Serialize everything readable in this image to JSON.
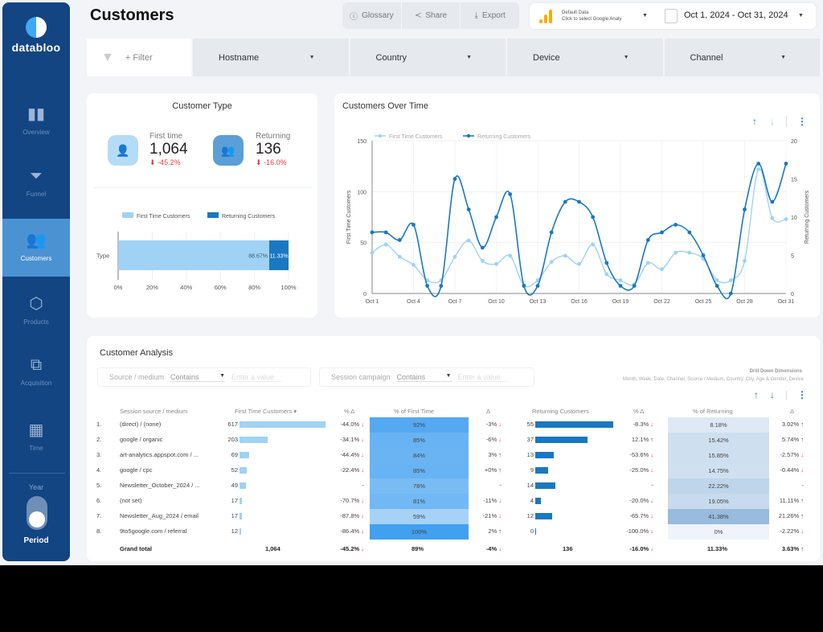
{
  "sidebar": {
    "brand": "databloo",
    "items": [
      {
        "label": "Overview",
        "icon": "bar-chart-icon",
        "active": false
      },
      {
        "label": "Funnel",
        "icon": "funnel-icon",
        "active": false
      },
      {
        "label": "Customers",
        "icon": "users-icon",
        "active": true
      },
      {
        "label": "Products",
        "icon": "box-icon",
        "active": false
      },
      {
        "label": "Acquisition",
        "icon": "hierarchy-icon",
        "active": false
      },
      {
        "label": "Time",
        "icon": "calendar-icon",
        "active": false
      }
    ],
    "toggle_top": "Year",
    "toggle_bottom": "Period"
  },
  "header": {
    "title": "Customers",
    "glossary": "Glossary",
    "share": "Share",
    "export": "Export",
    "datasource_line1": "Default Data",
    "datasource_line2": "Click to select Google Analy",
    "date_range": "Oct 1, 2024 - Oct 31, 2024"
  },
  "filters": {
    "add": "+ Filter",
    "dropdowns": [
      "Hostname",
      "Country",
      "Device",
      "Channel"
    ]
  },
  "customer_type": {
    "title": "Customer Type",
    "first": {
      "label": "First time",
      "value": "1,064",
      "delta": "-45.2%"
    },
    "returning": {
      "label": "Returning",
      "value": "136",
      "delta": "-16.0%"
    }
  },
  "over_time": {
    "title": "Customers Over Time"
  },
  "analysis": {
    "title": "Customer Analysis",
    "filter1": {
      "label": "Source / medium",
      "op": "Contains",
      "placeholder": "Enter a value"
    },
    "filter2": {
      "label": "Session campaign",
      "op": "Contains",
      "placeholder": "Enter a value"
    },
    "drill_title": "Drill Down Dimensions",
    "drill_list": "Month, Week, Date, Channel, Source / Medium,  Country, City, Age & Gender, Device",
    "headers": [
      "Session source / medium",
      "First Time Customers ▾",
      "% Δ",
      "% of First Time",
      "Δ",
      "Returning Customers",
      "% Δ",
      "% of Returning",
      "Δ"
    ],
    "rows": [
      {
        "n": "1.",
        "src": "(direct) / (none)",
        "ft": 617,
        "ftd": "-44.0%",
        "ftdd": "down",
        "pft": "92%",
        "pftv": 92,
        "d1": "-3%",
        "d1d": "down",
        "rt": 55,
        "rtd": "-8.3%",
        "rtdd": "down",
        "prt": "8.18%",
        "prtv": 8.18,
        "d2": "3.02%",
        "d2d": "up"
      },
      {
        "n": "2.",
        "src": "google / organic",
        "ft": 203,
        "ftd": "-34.1%",
        "ftdd": "down",
        "pft": "85%",
        "pftv": 85,
        "d1": "-6%",
        "d1d": "down",
        "rt": 37,
        "rtd": "12.1%",
        "rtdd": "up",
        "prt": "15.42%",
        "prtv": 15.42,
        "d2": "5.74%",
        "d2d": "up"
      },
      {
        "n": "3.",
        "src": "art-analytics.appspot.com / ...",
        "ft": 69,
        "ftd": "-44.4%",
        "ftdd": "down",
        "pft": "84%",
        "pftv": 84,
        "d1": "3%",
        "d1d": "up",
        "rt": 13,
        "rtd": "-53.6%",
        "rtdd": "down",
        "prt": "15.85%",
        "prtv": 15.85,
        "d2": "-2.57%",
        "d2d": "down"
      },
      {
        "n": "4.",
        "src": "google / cpc",
        "ft": 52,
        "ftd": "-22.4%",
        "ftdd": "down",
        "pft": "85%",
        "pftv": 85,
        "d1": "+0%",
        "d1d": "up",
        "rt": 9,
        "rtd": "-25.0%",
        "rtdd": "down",
        "prt": "14.75%",
        "prtv": 14.75,
        "d2": "-0.44%",
        "d2d": "down"
      },
      {
        "n": "5.",
        "src": "Newsletter_October_2024 / ...",
        "ft": 49,
        "ftd": "-",
        "ftdd": "",
        "pft": "78%",
        "pftv": 78,
        "d1": "-",
        "d1d": "",
        "rt": 14,
        "rtd": "-",
        "rtdd": "",
        "prt": "22.22%",
        "prtv": 22.22,
        "d2": "-",
        "d2d": ""
      },
      {
        "n": "6.",
        "src": "(not set)",
        "ft": 17,
        "ftd": "-70.7%",
        "ftdd": "down",
        "pft": "81%",
        "pftv": 81,
        "d1": "-11%",
        "d1d": "down",
        "rt": 4,
        "rtd": "-20.0%",
        "rtdd": "down",
        "prt": "19.05%",
        "prtv": 19.05,
        "d2": "11.11%",
        "d2d": "up"
      },
      {
        "n": "7.",
        "src": "Newsletter_Aug_2024 / email",
        "ft": 17,
        "ftd": "-87.8%",
        "ftdd": "down",
        "pft": "59%",
        "pftv": 59,
        "d1": "-21%",
        "d1d": "down",
        "rt": 12,
        "rtd": "-65.7%",
        "rtdd": "down",
        "prt": "41.38%",
        "prtv": 41.38,
        "d2": "21.26%",
        "d2d": "up"
      },
      {
        "n": "8.",
        "src": "9to5google.com / referral",
        "ft": 12,
        "ftd": "-86.4%",
        "ftdd": "down",
        "pft": "100%",
        "pftv": 100,
        "d1": "2%",
        "d1d": "up",
        "rt": 0,
        "rtd": "-100.0%",
        "rtdd": "down",
        "prt": "0%",
        "prtv": 0,
        "d2": "-2.22%",
        "d2d": "down"
      }
    ],
    "total": {
      "label": "Grand total",
      "ft": "1,064",
      "ftd": "-45.2%",
      "ftdd": "down",
      "pft": "89%",
      "d1": "-4%",
      "d1d": "down",
      "rt": "136",
      "rtd": "-16.0%",
      "rtdd": "down",
      "prt": "11.33%",
      "d2": "3.63%",
      "d2d": "up"
    }
  },
  "colors": {
    "sidebar": "#124581",
    "active": "#4b92d3",
    "first": "#9fd2f5",
    "returning": "#1a78c2",
    "negative": "#e23c3c"
  },
  "chart_data": [
    {
      "type": "bar",
      "stacked": true,
      "orientation": "horizontal",
      "categories": [
        "Type"
      ],
      "series": [
        {
          "name": "First Time Customers",
          "values": [
            88.67
          ],
          "label": "88.67%"
        },
        {
          "name": "Returning Customers",
          "values": [
            11.33
          ],
          "label": "11.33%"
        }
      ],
      "xlim": [
        0,
        100
      ],
      "xticks": [
        "0%",
        "20%",
        "40%",
        "60%",
        "80%",
        "100%"
      ],
      "legend": "top",
      "grid": true
    },
    {
      "type": "line",
      "title": "Customers Over Time",
      "x": [
        "Oct 1",
        "Oct 2",
        "Oct 3",
        "Oct 4",
        "Oct 5",
        "Oct 6",
        "Oct 7",
        "Oct 8",
        "Oct 9",
        "Oct 10",
        "Oct 11",
        "Oct 12",
        "Oct 13",
        "Oct 14",
        "Oct 15",
        "Oct 16",
        "Oct 17",
        "Oct 18",
        "Oct 19",
        "Oct 20",
        "Oct 21",
        "Oct 22",
        "Oct 23",
        "Oct 24",
        "Oct 25",
        "Oct 26",
        "Oct 27",
        "Oct 28",
        "Oct 29",
        "Oct 30",
        "Oct 31"
      ],
      "xticks": [
        "Oct 1",
        "Oct 4",
        "Oct 7",
        "Oct 10",
        "Oct 13",
        "Oct 16",
        "Oct 19",
        "Oct 22",
        "Oct 25",
        "Oct 28",
        "Oct 31"
      ],
      "series": [
        {
          "name": "First Time Customers",
          "axis": "left",
          "color": "#9fd2f5",
          "values": [
            40,
            48,
            36,
            28,
            13,
            13,
            36,
            52,
            32,
            29,
            37,
            8,
            13,
            31,
            37,
            29,
            48,
            19,
            13,
            9,
            30,
            24,
            40,
            40,
            34,
            13,
            13,
            32,
            122,
            74,
            73
          ]
        },
        {
          "name": "Returning Customers",
          "axis": "right",
          "color": "#1a78c2",
          "values": [
            8,
            8,
            7,
            9,
            1,
            1,
            15,
            11,
            6,
            10,
            13,
            1,
            1,
            8,
            12,
            12,
            10,
            4,
            1,
            1,
            7,
            8,
            9,
            8,
            5,
            1,
            0,
            11,
            17,
            12,
            17
          ]
        }
      ],
      "ylabel": "First Time Customers",
      "y2label": "Returning Customers",
      "ylim": [
        0,
        150
      ],
      "yticks": [
        "0",
        "50",
        "100",
        "150"
      ],
      "y2lim": [
        0,
        20
      ],
      "y2ticks": [
        "0",
        "5",
        "10",
        "15",
        "20"
      ],
      "legend": "top-left",
      "grid": true
    }
  ]
}
